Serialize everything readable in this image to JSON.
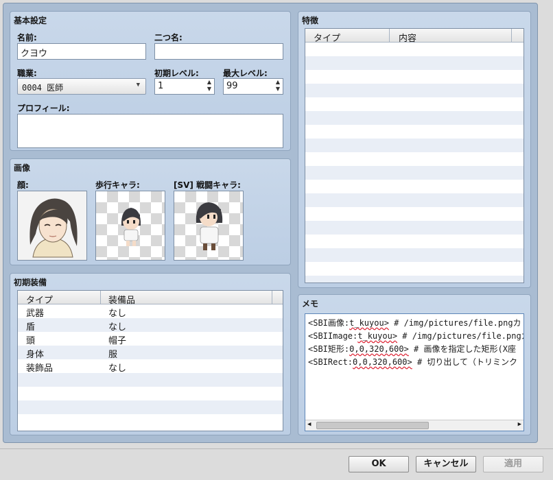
{
  "basic": {
    "title": "基本設定",
    "name_label": "名前:",
    "name_value": "クヨウ",
    "nickname_label": "二つ名:",
    "nickname_value": "",
    "class_label": "職業:",
    "class_value": "0004 医師",
    "initial_level_label": "初期レベル:",
    "initial_level_value": "1",
    "max_level_label": "最大レベル:",
    "max_level_value": "99",
    "profile_label": "プロフィール:",
    "profile_value": ""
  },
  "images": {
    "title": "画像",
    "face_label": "顔:",
    "walk_label": "歩行キャラ:",
    "battler_label": "[SV] 戦闘キャラ:"
  },
  "equipment": {
    "title": "初期装備",
    "col_type": "タイプ",
    "col_item": "装備品",
    "rows": [
      {
        "type": "武器",
        "item": "なし"
      },
      {
        "type": "盾",
        "item": "なし"
      },
      {
        "type": "頭",
        "item": "帽子"
      },
      {
        "type": "身体",
        "item": "服"
      },
      {
        "type": "装飾品",
        "item": "なし"
      }
    ]
  },
  "traits": {
    "title": "特徴",
    "col_type": "タイプ",
    "col_content": "内容"
  },
  "memo": {
    "title": "メモ",
    "lines": [
      {
        "pre": "<SBI画像:",
        "u": "t_kuyou>",
        "post": "  # /img/pictures/file.pngカ"
      },
      {
        "pre": "<SBIImage:",
        "u": "t_kuyou>",
        "post": " # /img/pictures/file.pngカ"
      },
      {
        "pre": "<SBI矩形:",
        "u": "0,0,320,600>",
        "post": " # 画像を指定した矩形(X座"
      },
      {
        "pre": "<SBIRect:",
        "u": "0,0,320,600>",
        "post": " # 切り出して（トリミンク"
      }
    ]
  },
  "buttons": {
    "ok": "OK",
    "cancel": "キャンセル",
    "apply": "適用"
  }
}
